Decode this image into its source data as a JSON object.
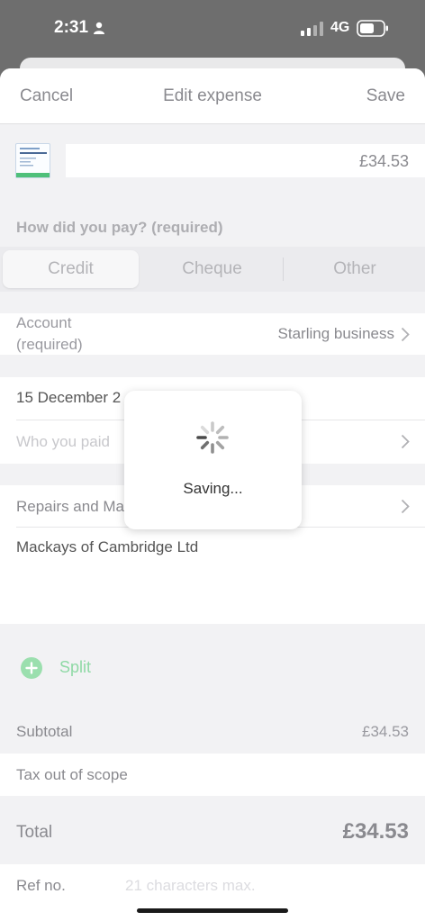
{
  "status_bar": {
    "time": "2:31",
    "network": "4G"
  },
  "nav": {
    "cancel": "Cancel",
    "title": "Edit expense",
    "save": "Save"
  },
  "amount": "£34.53",
  "payment": {
    "label": "How did you pay? (required)",
    "options": [
      "Credit",
      "Cheque",
      "Other"
    ],
    "selected": "Credit"
  },
  "account": {
    "label_line1": "Account",
    "label_line2": "(required)",
    "value": "Starling business"
  },
  "date_row": {
    "value": "15 December 2"
  },
  "payee": {
    "placeholder": "Who you paid"
  },
  "category": {
    "value": "Repairs and Ma"
  },
  "description": "Mackays of Cambridge Ltd",
  "split_label": "Split",
  "subtotal": {
    "label": "Subtotal",
    "value": "£34.53"
  },
  "tax": {
    "label": "Tax out of scope"
  },
  "total": {
    "label": "Total",
    "value": "£34.53"
  },
  "ref": {
    "label": "Ref no.",
    "placeholder": "21 characters max."
  },
  "hud": {
    "text": "Saving..."
  },
  "colors": {
    "accent_green": "#4fc07a",
    "dim_overlay": "#6e6e6e"
  }
}
